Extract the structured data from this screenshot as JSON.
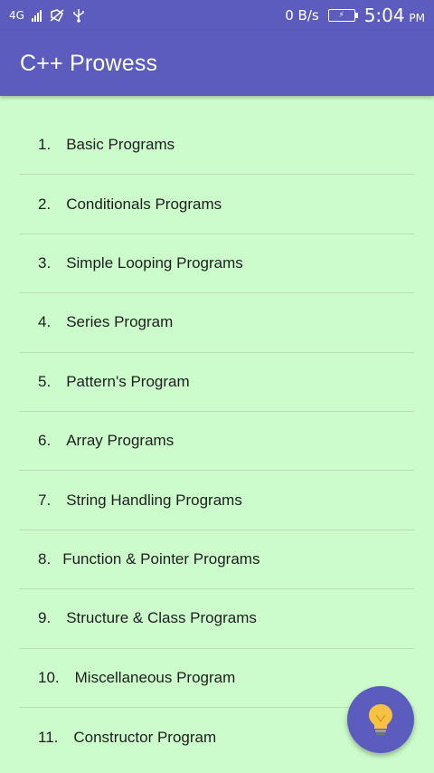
{
  "status_bar": {
    "network": "4G",
    "data_rate": "0 B/s",
    "time": "5:04",
    "ampm": "PM"
  },
  "app_bar": {
    "title": "C++ Prowess"
  },
  "menu": {
    "items": [
      {
        "number": "1.",
        "label": "Basic Programs"
      },
      {
        "number": "2.",
        "label": "Conditionals Programs"
      },
      {
        "number": "3.",
        "label": "Simple Looping Programs"
      },
      {
        "number": "4.",
        "label": "Series Program"
      },
      {
        "number": "5.",
        "label": "Pattern's Program"
      },
      {
        "number": "6.",
        "label": "Array Programs"
      },
      {
        "number": "7.",
        "label": "String Handling Programs"
      },
      {
        "number": "8.",
        "label": "Function & Pointer Programs"
      },
      {
        "number": "9.",
        "label": "Structure & Class Programs"
      },
      {
        "number": "10.",
        "label": "Miscellaneous Program"
      },
      {
        "number": "11.",
        "label": "Constructor Program"
      }
    ]
  },
  "fab": {
    "icon": "lightbulb-icon"
  },
  "colors": {
    "primary": "#5c5cbf",
    "background": "#ccfccc",
    "bulb": "#f5c242"
  }
}
